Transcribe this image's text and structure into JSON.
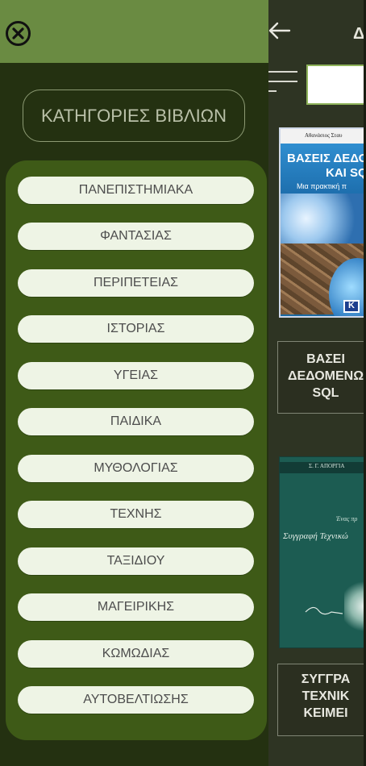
{
  "drawer": {
    "close_icon": "close-circle-icon",
    "heading": "ΚΑΤΗΓΟΡΙΕΣ ΒΙΒΛΙΩΝ",
    "categories": [
      "ΠΑΝΕΠΙΣΤΗΜΙΑΚΑ",
      "ΦΑΝΤΑΣΙΑΣ",
      "ΠΕΡΙΠΕΤΕΙΑΣ",
      "ΙΣΤΟΡΙΑΣ",
      "ΥΓΕΙΑΣ",
      "ΠΑΙΔΙΚΑ",
      "ΜΥΘΟΛΟΓΙΑΣ",
      "ΤΕΧΝΗΣ",
      "ΤΑΞΙΔΙΟΥ",
      "ΜΑΓΕΙΡΙΚΗΣ",
      "ΚΩΜΩΔΙΑΣ",
      "ΑΥΤΟΒΕΛΤΙΩΣΗΣ"
    ]
  },
  "page": {
    "back_icon": "arrow-left-icon",
    "title": "Δ",
    "menu_icon": "hamburger-menu-icon",
    "search_value": ""
  },
  "books": [
    {
      "cover_top_text": "Αθανάσιος Σταυ",
      "cover_title_line1": "ΒΑΣΕΙΣ ΔΕΔΟ",
      "cover_title_line2": "ΚΑΙ SQ",
      "cover_subtitle": "Μια πρακτική π",
      "cover_logo": "K",
      "title_lines": [
        "ΒΑΣΕΙ",
        "ΔΕΔΟΜΕΝΩ",
        "SQL"
      ]
    },
    {
      "cover_top_text": "Σ. Γ. ΑΠΟΡΓΙΑ",
      "cover_mid_text": "Ένας πρ",
      "cover_title": "Συγγραφή Τεχνικώ",
      "title_lines": [
        "ΣΥΓΓΡΑ",
        "ΤΕΧΝΙΚ",
        "ΚΕΙΜΕΙ"
      ]
    }
  ],
  "colors": {
    "drawer_bg": "#243111",
    "drawer_header": "#6a8b42",
    "category_panel": "#3e5a17",
    "category_pill": "#eef4e5",
    "page_bg": "#2e3423",
    "search_border": "#8eb35a"
  }
}
